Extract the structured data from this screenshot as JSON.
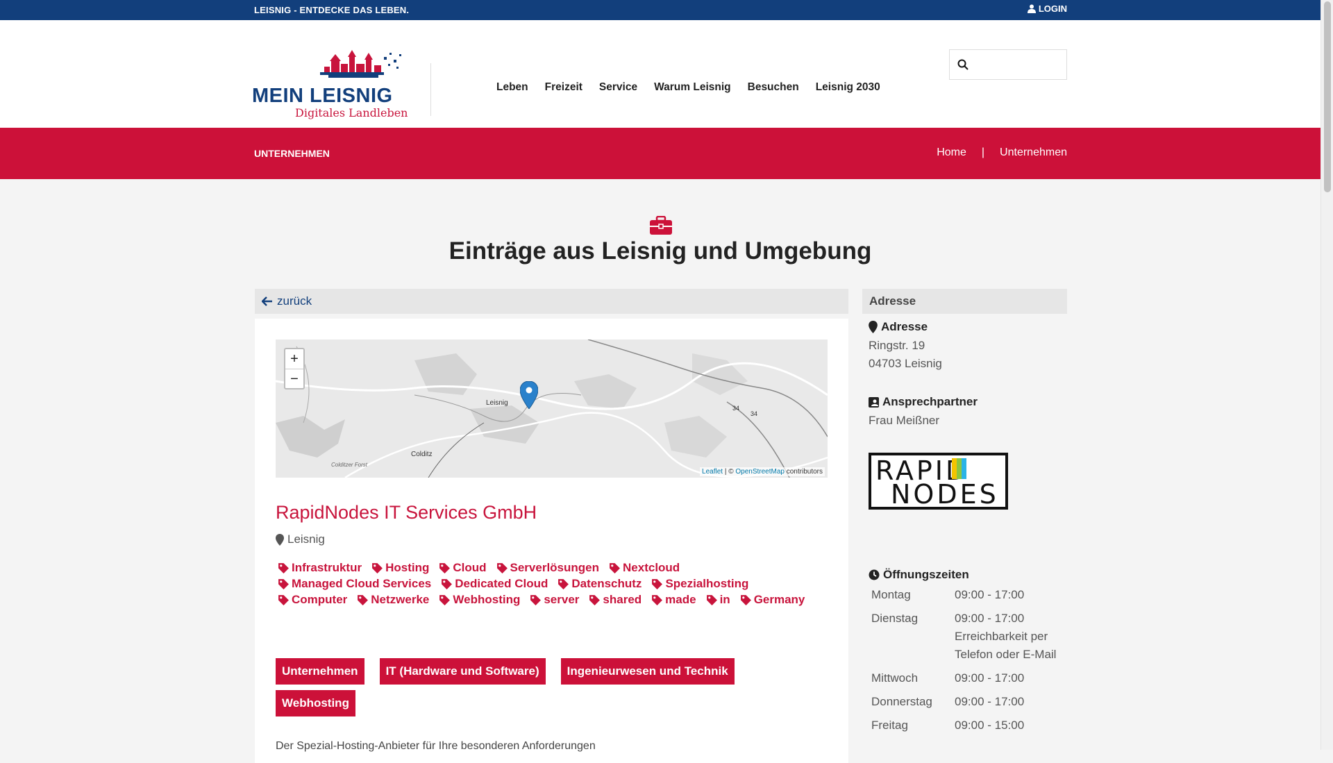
{
  "topbar": {
    "slogan": "LEISNIG - ENTDECKE DAS LEBEN.",
    "login": "LOGIN"
  },
  "logo": {
    "main": "MEIN LEISNIG",
    "sub": "Digitales Landleben"
  },
  "nav": [
    "Leben",
    "Freizeit",
    "Service",
    "Warum Leisnig",
    "Besuchen",
    "Leisnig 2030"
  ],
  "search": {
    "placeholder": ""
  },
  "banner": {
    "title": "UNTERNEHMEN",
    "breadcrumb": [
      "Home",
      "|",
      "Unternehmen"
    ]
  },
  "page": {
    "title": "Einträge aus Leisnig und Umgebung",
    "back": "zurück"
  },
  "map": {
    "zoom_in": "+",
    "zoom_out": "−",
    "places": {
      "leisnig": "Leisnig",
      "colditz": "Colditz",
      "forst": "Colditzer Forst",
      "road1": "34",
      "road2": "34"
    },
    "attrib_leaflet": "Leaflet",
    "attrib_sep": " | © ",
    "attrib_osm": "OpenStreetMap",
    "attrib_contrib": " contributors"
  },
  "company": {
    "name": "RapidNodes IT Services GmbH",
    "location": "Leisnig"
  },
  "tags": [
    "Infrastruktur",
    "Hosting",
    "Cloud",
    "Serverlösungen",
    "Nextcloud",
    "Managed Cloud Services",
    "Dedicated Cloud",
    "Datenschutz",
    "Spezialhosting",
    "Computer",
    "Netzwerke",
    "Webhosting",
    "server",
    "shared",
    "made",
    "in",
    "Germany"
  ],
  "categories": [
    "Unternehmen",
    "IT (Hardware und Software)",
    "Ingenieurwesen und Technik",
    "Webhosting"
  ],
  "description": "Der Spezial-Hosting-Anbieter für Ihre besonderen Anforderungen",
  "sidebar": {
    "head": "Adresse",
    "address_label": "Adresse",
    "address_line1": "Ringstr. 19",
    "address_line2": "04703 Leisnig",
    "contact_label": "Ansprechpartner",
    "contact_name": "Frau Meißner",
    "logo_line1": "RAPID",
    "logo_line2": "NODES",
    "hours_label": "Öffnungszeiten",
    "hours": [
      {
        "day": "Montag",
        "time": "09:00 - 17:00"
      },
      {
        "day": "Dienstag",
        "time": "09:00 - 17:00 Erreichbarkeit per Telefon oder E-Mail"
      },
      {
        "day": "Mittwoch",
        "time": "09:00 - 17:00"
      },
      {
        "day": "Donnerstag",
        "time": "09:00 - 17:00"
      },
      {
        "day": "Freitag",
        "time": "09:00 - 15:00"
      }
    ]
  },
  "colors": {
    "primary_blue": "#123f7c",
    "accent_red": "#cc1139"
  }
}
